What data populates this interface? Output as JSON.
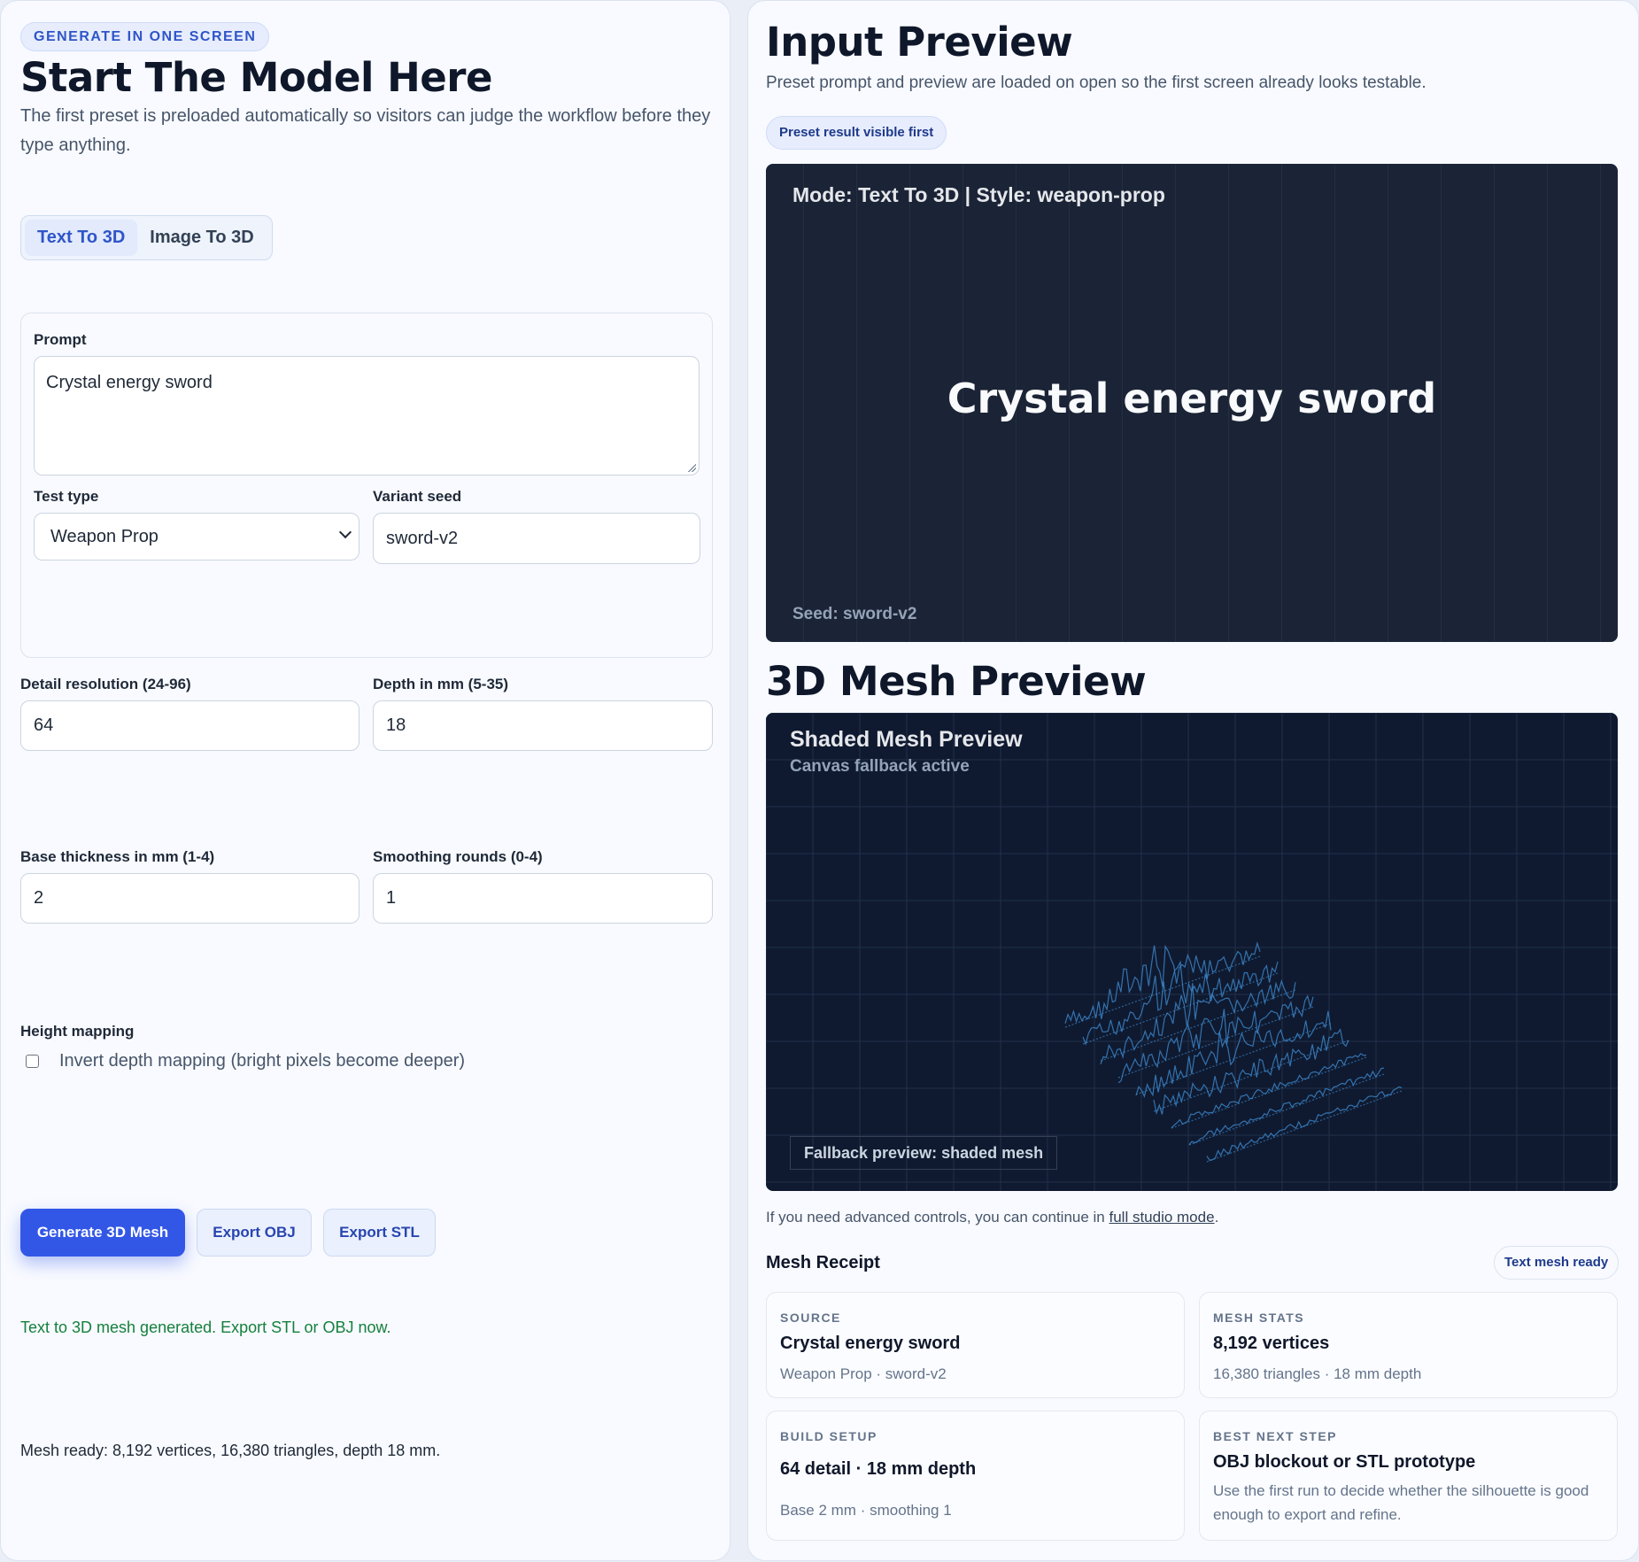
{
  "left": {
    "eyebrow": "GENERATE IN ONE SCREEN",
    "title": "Start The Model Here",
    "intro": "The first preset is preloaded automatically so visitors can judge the workflow before they type anything.",
    "modes": [
      {
        "label": "Text To 3D",
        "active": true
      },
      {
        "label": "Image To 3D",
        "active": false
      }
    ],
    "prompt": {
      "label": "Prompt",
      "value": "Crystal energy sword"
    },
    "test_type": {
      "label": "Test type",
      "value": "Weapon Prop"
    },
    "variant_seed": {
      "label": "Variant seed",
      "value": "sword-v2"
    },
    "detail_resolution": {
      "label": "Detail resolution (24-96)",
      "value": "64"
    },
    "depth": {
      "label": "Depth in mm (5-35)",
      "value": "18"
    },
    "base_thickness": {
      "label": "Base thickness in mm (1-4)",
      "value": "2"
    },
    "smoothing": {
      "label": "Smoothing rounds (0-4)",
      "value": "1"
    },
    "height_mapping": {
      "label": "Height mapping",
      "checkbox_label": "Invert depth mapping (bright pixels become deeper)",
      "checked": false
    },
    "buttons": {
      "generate": "Generate 3D Mesh",
      "export_obj": "Export OBJ",
      "export_stl": "Export STL"
    },
    "status_message": "Text to 3D mesh generated. Export STL or OBJ now.",
    "mesh_summary": "Mesh ready: 8,192 vertices, 16,380 triangles, depth 18 mm."
  },
  "right": {
    "input_preview": {
      "title": "Input Preview",
      "subtitle": "Preset prompt and preview are loaded on open so the first screen already looks testable.",
      "badge": "Preset result visible first",
      "mode_line": "Mode: Text To 3D | Style: weapon-prop",
      "prompt_text": "Crystal energy sword",
      "seed_line": "Seed: sword-v2"
    },
    "mesh_preview": {
      "title": "3D Mesh Preview",
      "canvas_title": "Shaded Mesh Preview",
      "canvas_subtitle": "Canvas fallback active",
      "fallback_label": "Fallback preview: shaded mesh"
    },
    "studio_line": {
      "prefix": "If you need advanced controls, you can continue in ",
      "link": "full studio mode",
      "suffix": "."
    },
    "receipt": {
      "title": "Mesh Receipt",
      "badge": "Text mesh ready",
      "cards": [
        {
          "eyebrow": "SOURCE",
          "main": "Crystal energy sword",
          "sub": "Weapon Prop · sword-v2"
        },
        {
          "eyebrow": "MESH STATS",
          "main": "8,192 vertices",
          "sub": "16,380 triangles · 18 mm depth"
        },
        {
          "eyebrow": "BUILD SETUP",
          "main": "64 detail · 18 mm depth",
          "sub": "Base 2 mm · smoothing 1"
        },
        {
          "eyebrow": "BEST NEXT STEP",
          "main": "OBJ blockout or STL prototype",
          "sub": "Use the first run to decide whether the silhouette is good enough to export and refine."
        }
      ]
    }
  },
  "colors": {
    "accent": "#3257e6",
    "success": "#15803d",
    "mesh_line": "#3b82c4",
    "preview_bg": "#1b2436",
    "mesh_bg": "#0f1a30"
  }
}
